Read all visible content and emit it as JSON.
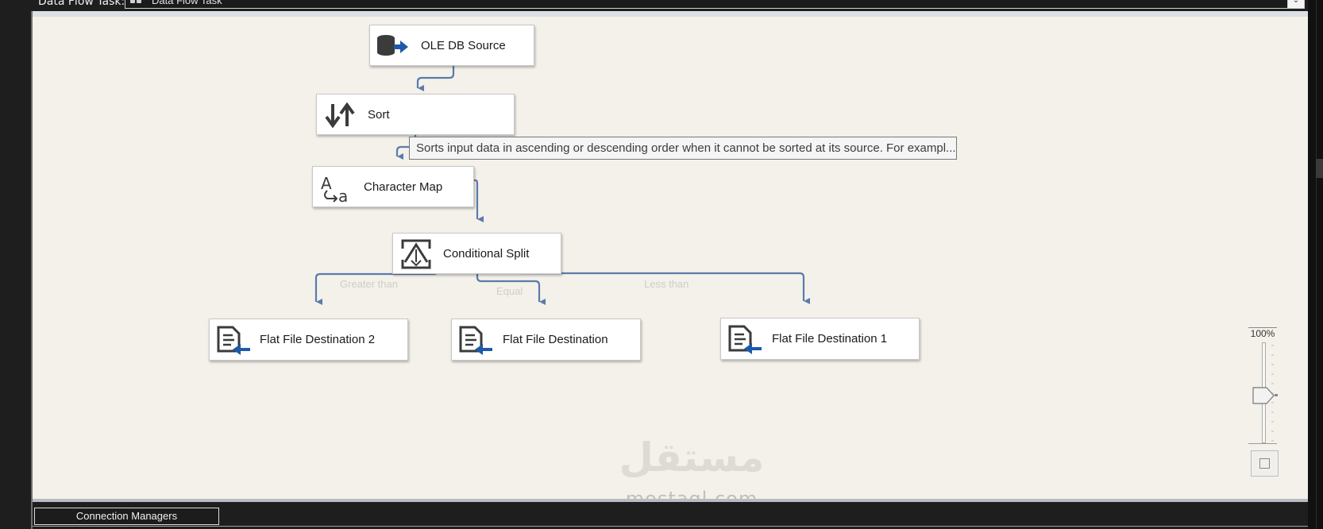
{
  "header": {
    "task_label": "Data Flow Task:",
    "task_value": "Data Flow Task"
  },
  "nodes": {
    "ole_db_source": "OLE DB Source",
    "sort": "Sort",
    "character_map": "Character Map",
    "conditional_split": "Conditional Split",
    "flat_file_destination_2": "Flat File Destination 2",
    "flat_file_destination": "Flat File Destination",
    "flat_file_destination_1": "Flat File Destination 1"
  },
  "tooltip": "Sorts input data in ascending or descending order when it cannot be sorted at its source. For exampl...",
  "paths": {
    "greater_than": "Greater than",
    "equal": "Equal",
    "less_than": "Less than"
  },
  "zoom": {
    "level": "100%"
  },
  "watermark": {
    "arabic": "مستقل",
    "latin": "mostaql.com"
  },
  "bottom": {
    "connection_managers": "Connection Managers"
  },
  "colors": {
    "canvas": "#f4f1ea",
    "wire": "#5b7bab",
    "arrow_blue": "#1e5aa8",
    "icon_dark": "#3b3b3b"
  }
}
